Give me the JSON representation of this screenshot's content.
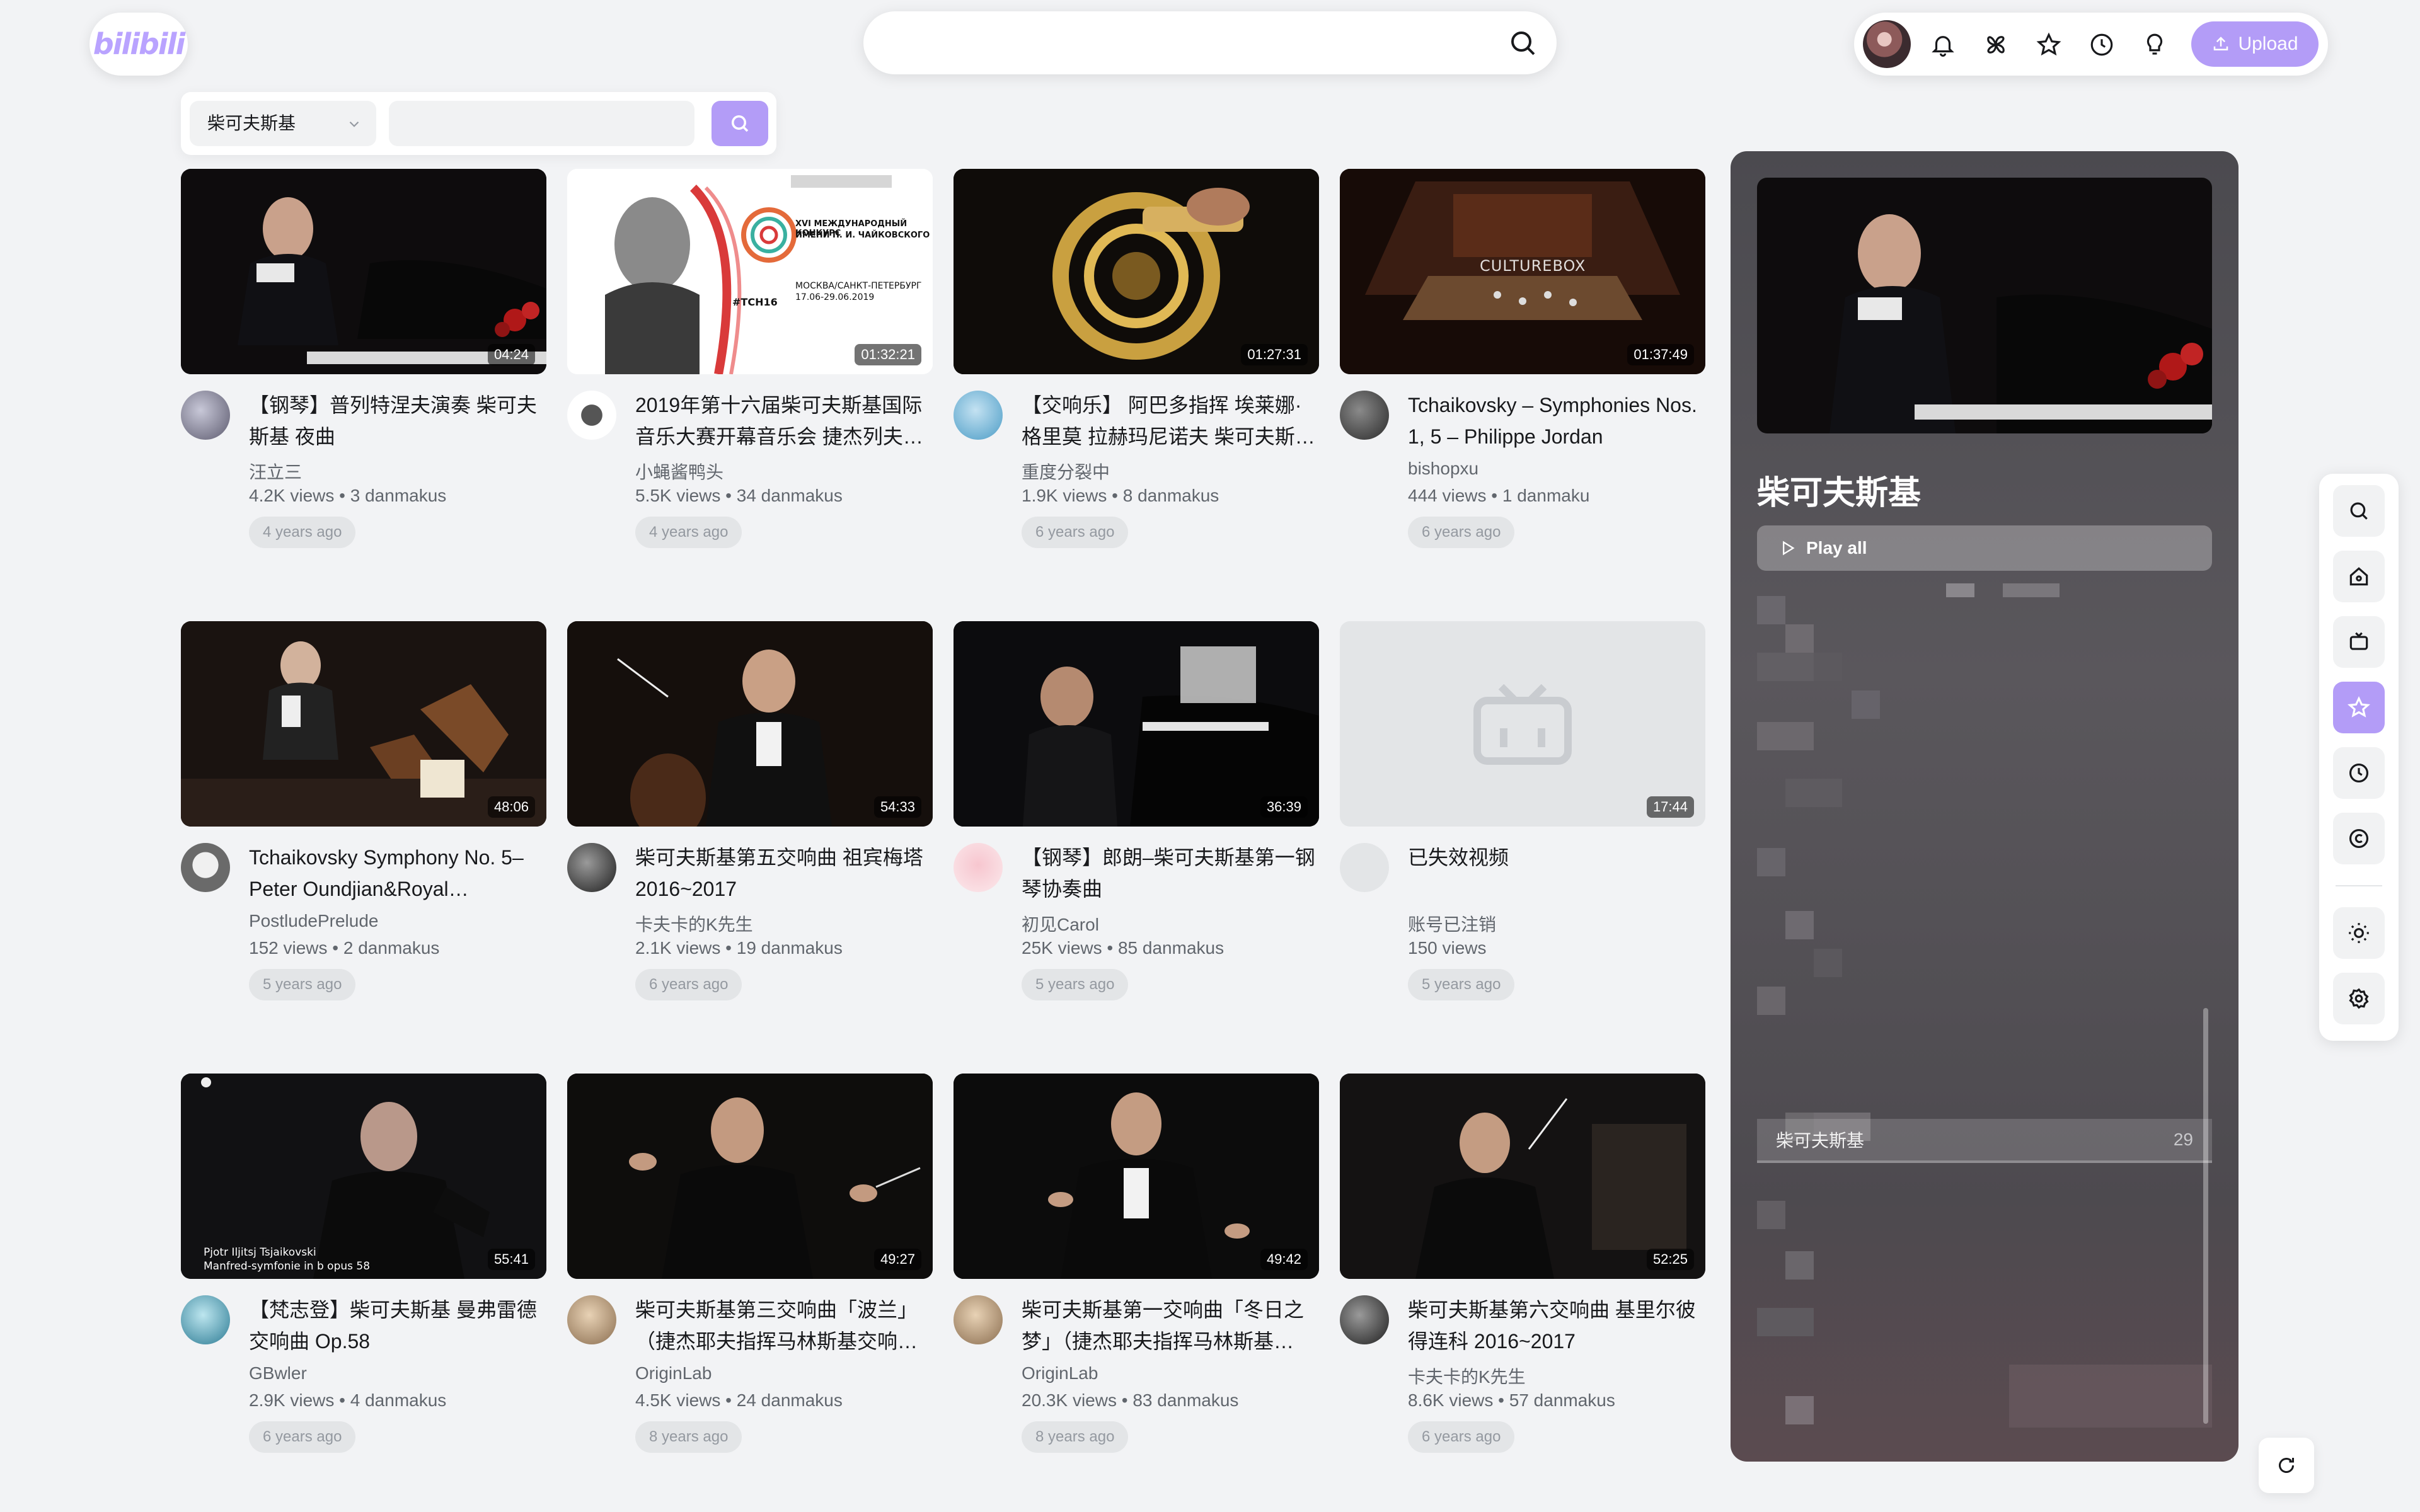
{
  "logo": {
    "text": "bilibili"
  },
  "search": {
    "placeholder": ""
  },
  "topbar": {
    "upload_label": "Upload"
  },
  "filter": {
    "selected": "柴可夫斯基",
    "placeholder": ""
  },
  "videos": [
    {
      "title": "【钢琴】普列特涅夫演奏 柴可夫斯基 夜曲",
      "uploader": "汪立三",
      "stats": "4.2K views • 3 danmakus",
      "age": "4 years ago",
      "duration": "04:24"
    },
    {
      "title": "2019年第十六届柴可夫斯基国际音乐大赛开幕音乐会 捷杰列夫…",
      "uploader": "小蝇酱鸭头",
      "stats": "5.5K views • 34 danmakus",
      "age": "4 years ago",
      "duration": "01:32:21"
    },
    {
      "title": "【交响乐】 阿巴多指挥 埃莱娜·格里莫 拉赫玛尼诺夫 柴可夫斯…",
      "uploader": "重度分裂中",
      "stats": "1.9K views • 8 danmakus",
      "age": "6 years ago",
      "duration": "01:27:31"
    },
    {
      "title": "Tchaikovsky – Symphonies Nos. 1, 5 – Philippe Jordan",
      "uploader": "bishopxu",
      "stats": "444 views • 1 danmaku",
      "age": "6 years ago",
      "duration": "01:37:49"
    },
    {
      "title": "Tchaikovsky Symphony No. 5–Peter Oundjian&Royal Stockhol…",
      "uploader": "PostludePrelude",
      "stats": "152 views • 2 danmakus",
      "age": "5 years ago",
      "duration": "48:06"
    },
    {
      "title": "柴可夫斯基第五交响曲 祖宾梅塔 2016~2017",
      "uploader": "卡夫卡的K先生",
      "stats": "2.1K views • 19 danmakus",
      "age": "6 years ago",
      "duration": "54:33"
    },
    {
      "title": "【钢琴】郎朗–柴可夫斯基第一钢琴协奏曲",
      "uploader": "初见Carol",
      "stats": "25K views • 85 danmakus",
      "age": "5 years ago",
      "duration": "36:39"
    },
    {
      "title": "已失效视频",
      "uploader": "账号已注销",
      "stats": "150 views",
      "age": "5 years ago",
      "duration": "17:44"
    },
    {
      "title": "【梵志登】柴可夫斯基 曼弗雷德交响曲 Op.58",
      "uploader": "GBwler",
      "stats": "2.9K views • 4 danmakus",
      "age": "6 years ago",
      "duration": "55:41"
    },
    {
      "title": "柴可夫斯基第三交响曲「波兰」（捷杰耶夫指挥马林斯基交响…",
      "uploader": "OriginLab",
      "stats": "4.5K views • 24 danmakus",
      "age": "8 years ago",
      "duration": "49:27"
    },
    {
      "title": "柴可夫斯基第一交响曲「冬日之梦」（捷杰耶夫指挥马林斯基…",
      "uploader": "OriginLab",
      "stats": "20.3K views • 83 danmakus",
      "age": "8 years ago",
      "duration": "49:42"
    },
    {
      "title": "柴可夫斯基第六交响曲 基里尔彼得连科 2016~2017",
      "uploader": "卡夫卡的K先生",
      "stats": "8.6K views • 57 danmakus",
      "age": "6 years ago",
      "duration": "52:25"
    }
  ],
  "thumb_text": {
    "culturebox": "CULTUREBOX",
    "tch16_line1": "XVI МЕЖДУНАРОДНЫЙ КОНКУРС",
    "tch16_line2": "ИМЕНИ П. И. ЧАЙКОВСКОГО",
    "tch16_city": "МОСКВА/САНКТ-ПЕТЕРБУРГ",
    "tch16_dates": "17.06-29.06.2019",
    "tch16_tag": "#TCH16",
    "manfred_line1": "Pjotr Iljitsj Tsjaikovski",
    "manfred_line2": "Manfred-symfonie in b opus 58"
  },
  "panel": {
    "title": "柴可夫斯基",
    "play_all": "Play all",
    "list_name": "柴可夫斯基",
    "list_count": "29"
  },
  "colors": {
    "accent": "#b39cf7",
    "background": "#f2f3f5"
  }
}
